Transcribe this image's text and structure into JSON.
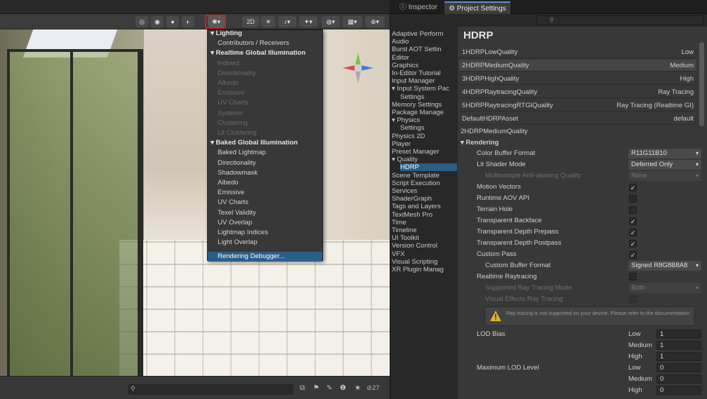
{
  "scene": {
    "toolbar": {
      "btn_2d": "2D"
    },
    "search_placeholder": "",
    "visibility_count": "27",
    "debug_menu": {
      "items": [
        {
          "label": "Lighting",
          "kind": "header"
        },
        {
          "label": "Contributors / Receivers",
          "kind": "item"
        },
        {
          "label": "Realtime Global Illumination",
          "kind": "header"
        },
        {
          "label": "Indirect",
          "kind": "disabled"
        },
        {
          "label": "Directionality",
          "kind": "disabled"
        },
        {
          "label": "Albedo",
          "kind": "disabled"
        },
        {
          "label": "Emissive",
          "kind": "disabled"
        },
        {
          "label": "UV Charts",
          "kind": "disabled"
        },
        {
          "label": "Systems",
          "kind": "disabled"
        },
        {
          "label": "Clustering",
          "kind": "disabled"
        },
        {
          "label": "Lit Clustering",
          "kind": "disabled"
        },
        {
          "label": "Baked Global Illumination",
          "kind": "header"
        },
        {
          "label": "Baked Lightmap",
          "kind": "item"
        },
        {
          "label": "Directionality",
          "kind": "item"
        },
        {
          "label": "Shadowmask",
          "kind": "item"
        },
        {
          "label": "Albedo",
          "kind": "item"
        },
        {
          "label": "Emissive",
          "kind": "item"
        },
        {
          "label": "UV Charts",
          "kind": "item"
        },
        {
          "label": "Texel Validity",
          "kind": "item"
        },
        {
          "label": "UV Overlap",
          "kind": "item"
        },
        {
          "label": "Lightmap Indices",
          "kind": "item"
        },
        {
          "label": "Light Overlap",
          "kind": "item"
        },
        {
          "label": "Rendering Debugger...",
          "kind": "selected"
        }
      ]
    }
  },
  "tabs": {
    "inspector": "Inspector",
    "project_settings": "Project Settings"
  },
  "nav": [
    {
      "label": "Adaptive Perform",
      "indent": false
    },
    {
      "label": "Audio",
      "indent": false
    },
    {
      "label": "Burst AOT Settin",
      "indent": false
    },
    {
      "label": "Editor",
      "indent": false
    },
    {
      "label": "Graphics",
      "indent": false
    },
    {
      "label": "In-Editor Tutorial",
      "indent": false
    },
    {
      "label": "Input Manager",
      "indent": false
    },
    {
      "label": "▾ Input System Pac",
      "indent": false
    },
    {
      "label": "Settings",
      "indent": true
    },
    {
      "label": "Memory Settings",
      "indent": false
    },
    {
      "label": "Package Manage",
      "indent": false
    },
    {
      "label": "▾ Physics",
      "indent": false
    },
    {
      "label": "Settings",
      "indent": true
    },
    {
      "label": "Physics 2D",
      "indent": false
    },
    {
      "label": "Player",
      "indent": false
    },
    {
      "label": "Preset Manager",
      "indent": false
    },
    {
      "label": "▾ Quality",
      "indent": false
    },
    {
      "label": "HDRP",
      "indent": true,
      "selected": true
    },
    {
      "label": "Scene Template",
      "indent": false
    },
    {
      "label": "Script Execution",
      "indent": false
    },
    {
      "label": "Services",
      "indent": false
    },
    {
      "label": "ShaderGraph",
      "indent": false
    },
    {
      "label": "Tags and Layers",
      "indent": false
    },
    {
      "label": "TextMesh Pro",
      "indent": false
    },
    {
      "label": "Time",
      "indent": false
    },
    {
      "label": "Timeline",
      "indent": false
    },
    {
      "label": "UI Toolkit",
      "indent": false
    },
    {
      "label": "Version Control",
      "indent": false
    },
    {
      "label": "VFX",
      "indent": false
    },
    {
      "label": "Visual Scripting",
      "indent": false
    },
    {
      "label": "XR Plugin Manag",
      "indent": false
    }
  ],
  "hdrp": {
    "title": "HDRP",
    "quality_rows": [
      {
        "name": "1HDRPLowQuality",
        "value": "Low"
      },
      {
        "name": "2HDRPMediumQuality",
        "value": "Medium",
        "selected": true
      },
      {
        "name": "3HDRPHighQuality",
        "value": "High"
      },
      {
        "name": "4HDRPRaytracingQuality",
        "value": "Ray Tracing"
      },
      {
        "name": "5HDRPRaytracingRTGIQuality",
        "value": "Ray Tracing (Realtime GI)"
      },
      {
        "name": "DefaultHDRPAsset",
        "value": "default"
      }
    ],
    "current_asset": "2HDRPMediumQuality",
    "section": "▾ Rendering",
    "color_buffer_format": {
      "label": "Color Buffer Format",
      "value": "R11G11B10"
    },
    "lit_shader_mode": {
      "label": "Lit Shader Mode",
      "value": "Deferred Only"
    },
    "msaa": {
      "label": "Multisample Anti-aliasing Quality",
      "value": "None"
    },
    "checks": [
      {
        "label": "Motion Vectors",
        "checked": "✓"
      },
      {
        "label": "Runtime AOV API",
        "checked": ""
      },
      {
        "label": "Terrain Hole",
        "checked": ""
      },
      {
        "label": "Transparent Backface",
        "checked": "✓"
      },
      {
        "label": "Transparent Depth Prepass",
        "checked": "✓"
      },
      {
        "label": "Transparent Depth Postpass",
        "checked": "✓"
      },
      {
        "label": "Custom Pass",
        "checked": "✓"
      }
    ],
    "custom_buffer_format": {
      "label": "Custom Buffer Format",
      "value": "Signed R8G8B8A8"
    },
    "realtime_raytracing": {
      "label": "Realtime Raytracing",
      "checked": ""
    },
    "supported_rt_mode": {
      "label": "Supported Ray Tracing Mode",
      "value": "Both"
    },
    "visual_effects_rt": {
      "label": "Visual Effects Ray Tracing",
      "checked": ""
    },
    "warning": "Ray tracing is not supported on your device. Please refer to the documentation.",
    "lod_bias": {
      "label": "LOD Bias",
      "rows": [
        {
          "k": "Low",
          "v": "1"
        },
        {
          "k": "Medium",
          "v": "1"
        },
        {
          "k": "High",
          "v": "1"
        }
      ]
    },
    "max_lod": {
      "label": "Maximum LOD Level",
      "rows": [
        {
          "k": "Low",
          "v": "0"
        },
        {
          "k": "Medium",
          "v": "0"
        },
        {
          "k": "High",
          "v": "0"
        }
      ]
    }
  },
  "colors": {
    "accent": "#2c5d87",
    "highlight_box": "#d02020"
  }
}
